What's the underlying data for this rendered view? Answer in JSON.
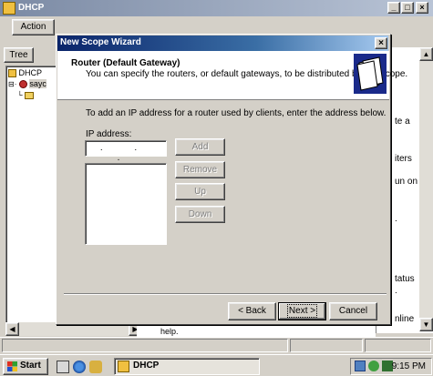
{
  "background_window": {
    "title": "DHCP",
    "menu_action": "Action",
    "tab_tree": "Tree",
    "tree_items": [
      "DHCP",
      "sayc"
    ],
    "right_pane_fragments": [
      "te a",
      "iters",
      "un on",
      ".",
      "tatus",
      ".",
      "nline"
    ],
    "help_text": "help."
  },
  "wizard": {
    "title": "New Scope Wizard",
    "header_title": "Router (Default Gateway)",
    "header_subtitle": "You can specify the routers, or default gateways, to be distributed by this scope.",
    "instruction": "To add an IP address for a router used by clients, enter the address below.",
    "ip_label": "IP address:",
    "ip_value_placeholder": ". . .",
    "buttons": {
      "add": "Add",
      "remove": "Remove",
      "up": "Up",
      "down": "Down",
      "back": "< Back",
      "next": "Next >",
      "cancel": "Cancel"
    }
  },
  "taskbar": {
    "start": "Start",
    "task_dhcp": "DHCP",
    "clock": "9:15 PM"
  },
  "colors": {
    "wizard_title_active": "#0a246a",
    "background_title_inactive": "#7b8aa4",
    "face": "#d4d0c8"
  },
  "icons": [
    "dhcp-icon",
    "close-icon",
    "minimize-icon",
    "maximize-icon",
    "folder-icon",
    "server-icon",
    "book-folder-icon",
    "windows-flag-icon",
    "network-tray-icon"
  ]
}
